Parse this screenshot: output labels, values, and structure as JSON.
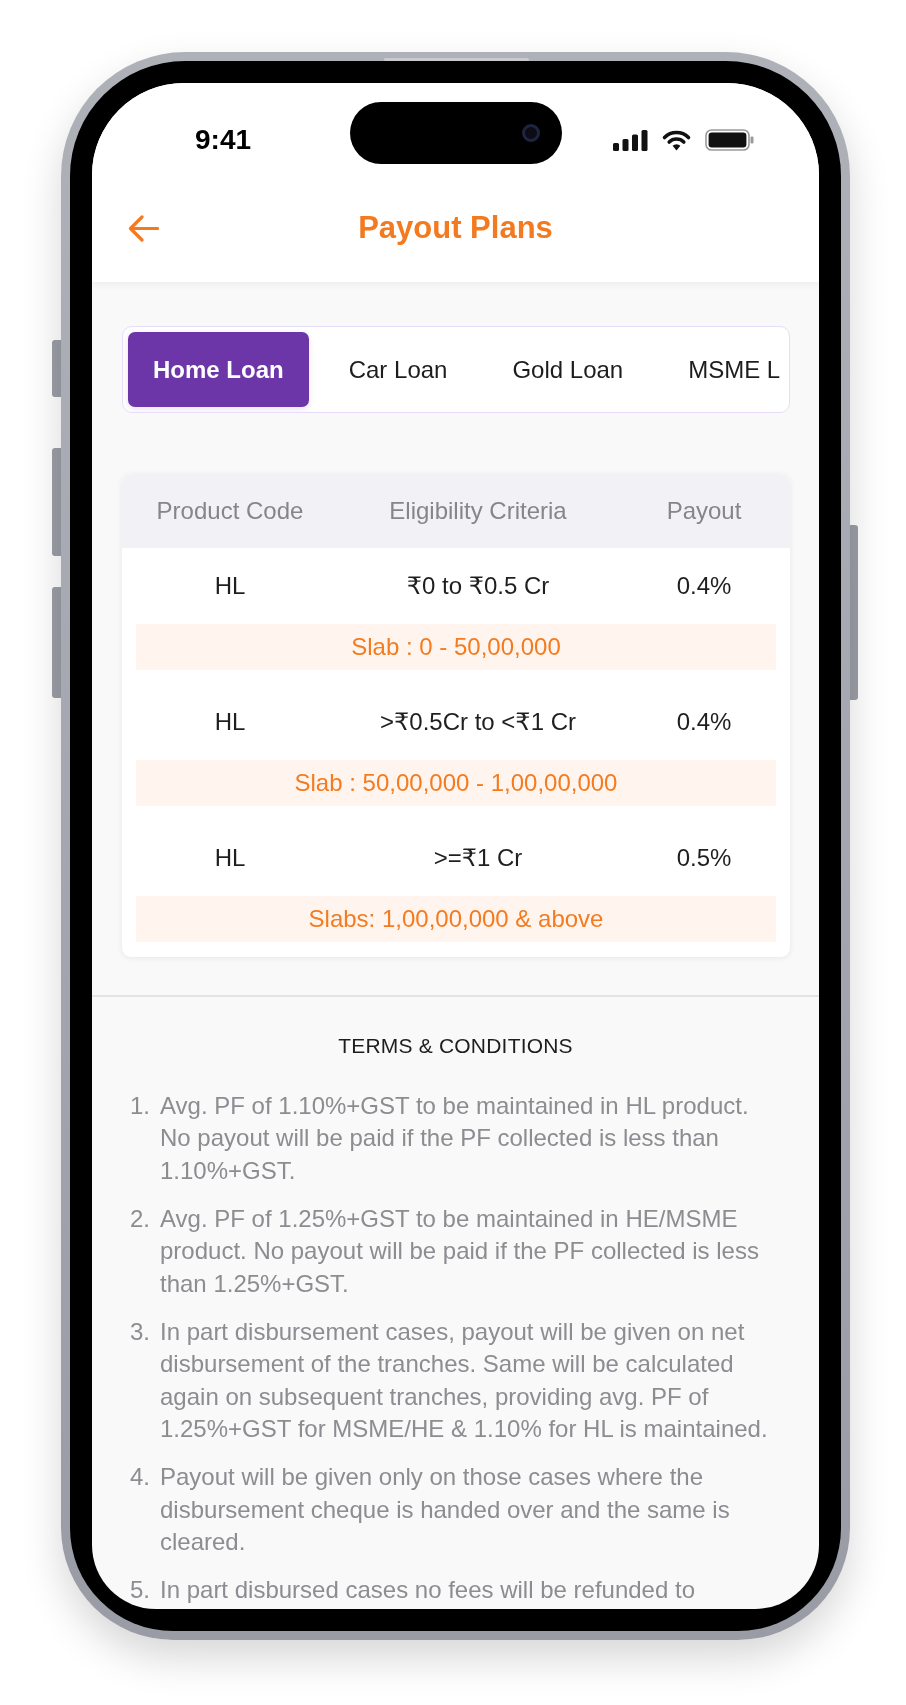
{
  "status_bar": {
    "time": "9:41"
  },
  "header": {
    "title": "Payout Plans"
  },
  "tabs": [
    {
      "label": "Home Loan",
      "selected": true
    },
    {
      "label": "Car Loan",
      "selected": false
    },
    {
      "label": "Gold Loan",
      "selected": false
    },
    {
      "label": "MSME L",
      "selected": false
    }
  ],
  "table": {
    "columns": [
      "Product Code",
      "Eligibility Criteria",
      "Payout"
    ],
    "rows": [
      {
        "cells": [
          "HL",
          "₹0 to ₹0.5 Cr",
          "0.4%"
        ],
        "slab": "Slab : 0 - 50,00,000"
      },
      {
        "cells": [
          "HL",
          ">₹0.5Cr to <₹1 Cr",
          "0.4%"
        ],
        "slab": "Slab : 50,00,000 - 1,00,00,000"
      },
      {
        "cells": [
          "HL",
          ">=₹1 Cr",
          "0.5%"
        ],
        "slab": "Slabs: 1,00,00,000 & above"
      }
    ]
  },
  "terms": {
    "title": "TERMS & CONDITIONS",
    "items": [
      {
        "number": "1.",
        "text": "Avg. PF of 1.10%+GST to be maintained in HL product. No payout will be paid if the PF collected is less than 1.10%+GST."
      },
      {
        "number": "2.",
        "text": "Avg. PF of 1.25%+GST to be maintained in HE/MSME product. No payout will be paid if the PF collected is less than 1.25%+GST."
      },
      {
        "number": "3.",
        "text": "In part disbursement cases, payout will be given on net disbursement of the tranches. Same will be calculated again on subsequent tranches, providing avg. PF of 1.25%+GST for MSME/HE & 1.10% for HL is maintained."
      },
      {
        "number": "4.",
        "text": "Payout will be given only on those cases where the disbursement cheque is handed over and the same is cleared."
      },
      {
        "number": "5.",
        "text": "In part disbursed cases no fees will be refunded to"
      }
    ]
  }
}
